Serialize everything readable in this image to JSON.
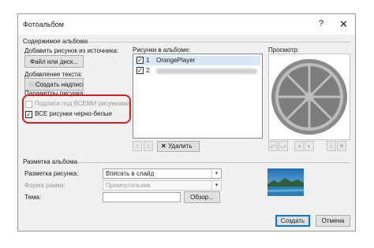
{
  "window": {
    "title": "Фотоальбом",
    "help": "?",
    "close": "✕"
  },
  "album_content": {
    "section_label": "Содержимое альбома",
    "add_from_label": "Добавить рисунок из источника:",
    "file_disk_button": "Файл или диск...",
    "add_text_label": "Добавление текста:",
    "new_caption_button": "Создать надпись"
  },
  "picture_options": {
    "section_label": "Параметры рисунка:",
    "captions_below_all": {
      "label": "Подписи под ВСЕМИ рисунками",
      "checked": false,
      "enabled": false
    },
    "all_black_white": {
      "label": "ВСЕ рисунки черно-белые",
      "checked": true,
      "enabled": true
    }
  },
  "album_pictures": {
    "label": "Рисунки в альбоме:",
    "items": [
      {
        "index": "1",
        "name": "OrangePlayer",
        "checked": true
      },
      {
        "index": "2",
        "name": "",
        "checked": true
      }
    ],
    "toolbar": {
      "up_icon": "arrow-up-icon",
      "down_icon": "arrow-down-icon",
      "delete_label": "Удалить"
    }
  },
  "preview": {
    "label": "Просмотр:",
    "tools": [
      "rotate-left-icon",
      "rotate-right-icon",
      "contrast-up-icon",
      "contrast-down-icon",
      "brightness-up-icon",
      "brightness-down-icon"
    ]
  },
  "album_layout": {
    "section_label": "Разметка альбома",
    "picture_layout": {
      "label": "Разметка рисунка:",
      "value": "Вписать в слайд"
    },
    "frame_shape": {
      "label": "Форма рамки:",
      "value": "Прямоугольник",
      "enabled": false
    },
    "theme": {
      "label": "Тема:",
      "value": "",
      "browse_button": "Обзор..."
    }
  },
  "footer": {
    "create_button": "Создать",
    "cancel_button": "Отмена"
  },
  "colors": {
    "accent": "#0078d7",
    "highlight": "#d42020",
    "preview_slice": "#8a8a8a"
  }
}
